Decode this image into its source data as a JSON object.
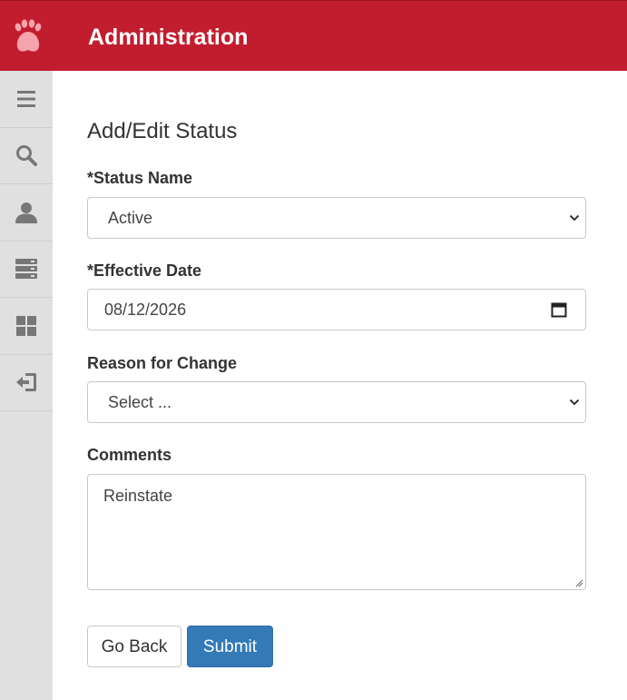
{
  "header": {
    "title": "Administration",
    "logo_icon": "paw-icon",
    "background_color": "#c21d2f"
  },
  "sidebar": {
    "items": [
      {
        "icon": "hamburger-menu-icon"
      },
      {
        "icon": "search-icon"
      },
      {
        "icon": "user-icon"
      },
      {
        "icon": "server-list-icon"
      },
      {
        "icon": "dashboard-grid-icon"
      },
      {
        "icon": "sign-out-icon"
      }
    ]
  },
  "form": {
    "title": "Add/Edit Status",
    "status_name": {
      "label": "*Status Name",
      "value": "Active"
    },
    "effective_date": {
      "label": "*Effective Date",
      "value": "08/12/2026"
    },
    "reason": {
      "label": "Reason for Change",
      "value": "Select ..."
    },
    "comments": {
      "label": "Comments",
      "value": "Reinstate"
    },
    "buttons": {
      "back_label": "Go Back",
      "submit_label": "Submit",
      "submit_color": "#337ab7"
    }
  }
}
